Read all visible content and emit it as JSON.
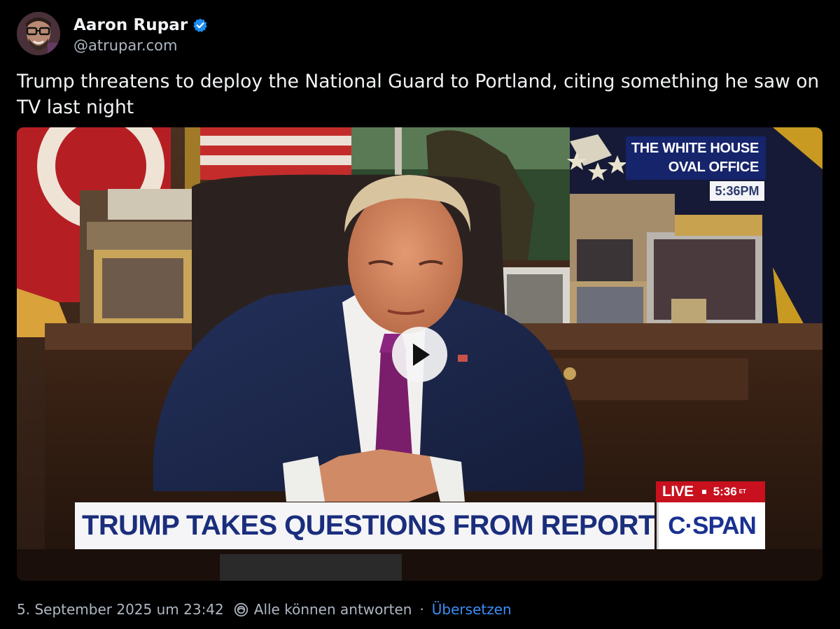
{
  "author": {
    "display_name": "Aaron Rupar",
    "handle": "@atrupar.com",
    "verified": true,
    "avatar_icon": "avatar-photo"
  },
  "post": {
    "text": "Trump threatens to deploy the National Guard to Portland, citing something he saw on TV last night"
  },
  "video": {
    "bug_line1": "THE WHITE HOUSE",
    "bug_line2": "OVAL OFFICE",
    "bug_time": "5:36PM",
    "live_label": "LIVE",
    "live_time": "5:36",
    "live_tz": "ET",
    "lower_third": "TRUMP TAKES QUESTIONS FROM REPORTERS",
    "network": "C·SPAN",
    "play_icon": "play-icon"
  },
  "footer": {
    "timestamp": "5. September 2025 um 23:42",
    "reply_icon": "reply-permission-icon",
    "reply_setting": "Alle können antworten",
    "separator": "·",
    "translate_label": "Übersetzen"
  },
  "colors": {
    "background": "#000000",
    "text_primary": "#f1f3f5",
    "text_secondary": "#aeb7c2",
    "link": "#3b8ef6",
    "verified_badge": "#1d8cf0",
    "cspan_blue": "#1a3192",
    "live_red": "#c8101e"
  }
}
